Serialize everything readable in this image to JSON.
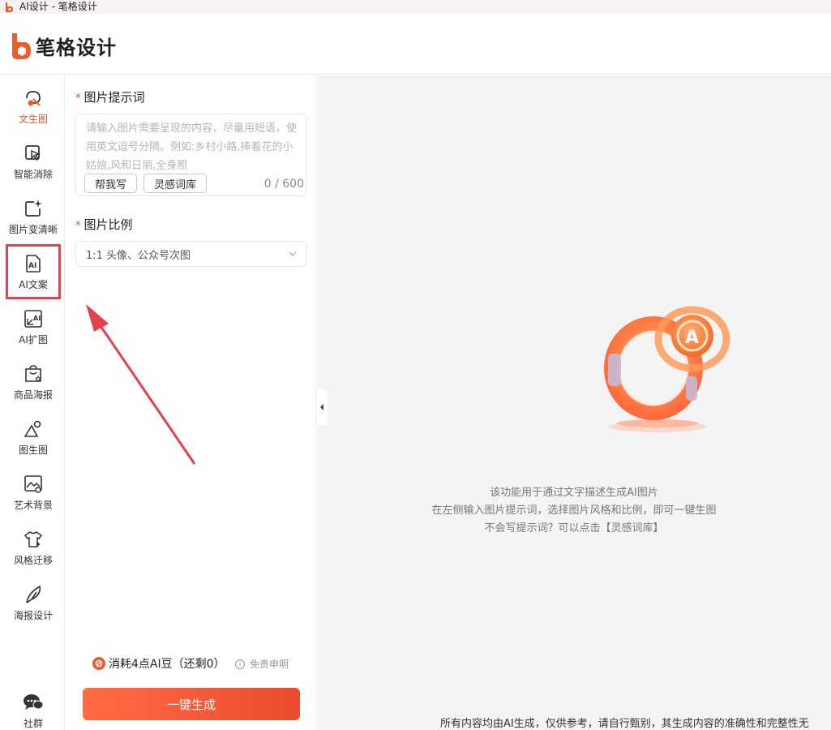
{
  "window": {
    "title": "AI设计 - 笔格设计"
  },
  "header": {
    "logo_text": "笔格设计"
  },
  "nav": {
    "items": [
      {
        "label": "文生图",
        "icon": "text-to-image-icon",
        "active": true
      },
      {
        "label": "智能消除",
        "icon": "smart-erase-icon"
      },
      {
        "label": "图片变清晰",
        "icon": "enhance-icon"
      },
      {
        "label": "AI文案",
        "icon": "ai-copy-icon",
        "highlighted": true
      },
      {
        "label": "AI扩图",
        "icon": "ai-expand-icon"
      },
      {
        "label": "商品海报",
        "icon": "product-poster-icon"
      },
      {
        "label": "图生图",
        "icon": "image-to-image-icon"
      },
      {
        "label": "艺术背景",
        "icon": "art-background-icon"
      },
      {
        "label": "风格迁移",
        "icon": "style-transfer-icon"
      },
      {
        "label": "海报设计",
        "icon": "poster-design-icon"
      }
    ],
    "community": {
      "label": "社群",
      "icon": "chat-icon"
    }
  },
  "form": {
    "prompt_label": "图片提示词",
    "prompt_placeholder": "请输入图片需要呈现的内容，尽量用短语，使用英文逗号分隔。例如:乡村小路,捧着花的小姑娘,风和日丽,全身照",
    "help_write": "帮我写",
    "inspiration": "灵感词库",
    "counter": "0 / 600",
    "ratio_label": "图片比例",
    "ratio_value": "1:1 头像、公众号次图",
    "cost_text": "消耗4点AI豆（还剩0）",
    "disclaimer": "免责申明",
    "generate": "一键生成"
  },
  "stage": {
    "line1": "该功能用于通过文字描述生成AI图片",
    "line2": "在左侧输入图片提示词，选择图片风格和比例，即可一键生图",
    "line3": "不会写提示词？可以点击【灵感词库】",
    "footer": "所有内容均由AI生成，仅供参考，请自行甄别，其生成内容的准确性和完整性无"
  },
  "colors": {
    "accent": "#f05a2a",
    "highlight_box": "#e5414b",
    "arrow": "#e5414b"
  }
}
